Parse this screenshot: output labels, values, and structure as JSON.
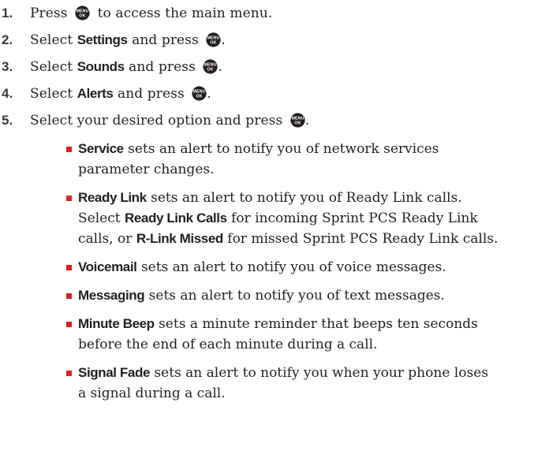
{
  "steps": [
    {
      "number": "1.",
      "before": "Press",
      "term": "",
      "after": "to access the main menu.",
      "has_key": true,
      "key_mid": true
    },
    {
      "number": "2.",
      "before": "Select",
      "term": "Settings",
      "after": "and press",
      "has_key": true,
      "key_mid": false
    },
    {
      "number": "3.",
      "before": "Select",
      "term": "Sounds",
      "after": "and press",
      "has_key": true,
      "key_mid": false
    },
    {
      "number": "4.",
      "before": "Select",
      "term": "Alerts",
      "after": "and press",
      "has_key": true,
      "key_mid": false
    },
    {
      "number": "5.",
      "before": "Select your desired option and press",
      "term": "",
      "after": "",
      "has_key": true,
      "key_mid": false
    }
  ],
  "menu_key": {
    "icon": "menu-ok-key-icon",
    "top_label": "MENU",
    "bottom_label": "OK",
    "color": "#231f20"
  },
  "bullets": [
    {
      "term": "Service",
      "lines": [
        " sets an alert to notify you of network services",
        "parameter changes."
      ]
    },
    {
      "term": "Ready Link",
      "lines": [
        " sets an alert to notify you of Ready Link calls.",
        "Select ",
        "calls, or "
      ],
      "term2": "Ready Link Calls",
      "line2_after": " for incoming Sprint PCS Ready Link",
      "term3": "R-Link Missed",
      "line3_after": " for missed Sprint PCS Ready Link calls."
    },
    {
      "term": "Voicemail",
      "lines": [
        " sets an alert to notify you of voice messages."
      ]
    },
    {
      "term": "Messaging",
      "lines": [
        " sets an alert to notify you of text messages."
      ]
    },
    {
      "term": "Minute Beep",
      "lines": [
        " sets a minute reminder that beeps ten seconds",
        "before the end of each minute during a call."
      ]
    },
    {
      "term": "Signal Fade",
      "lines": [
        " sets an alert to notify you when your phone loses",
        "a signal during a call."
      ]
    }
  ],
  "punctuation": {
    "period": "."
  },
  "colors": {
    "bullet": "#d9241c",
    "text": "#231f20",
    "step_number": "#3a3a3a"
  }
}
